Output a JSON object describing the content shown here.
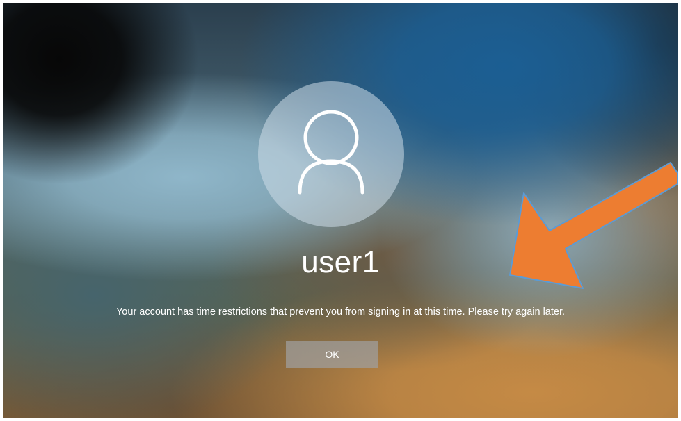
{
  "lock_screen": {
    "avatar_icon": "user-silhouette-icon",
    "username": "user1",
    "message": "Your account has time restrictions that prevent you from signing in at this time. Please try again later.",
    "ok_label": "OK"
  },
  "annotation": {
    "arrow_icon": "orange-arrow-icon",
    "arrow_color": "#ED7D31",
    "arrow_outline_color": "#5B9BD5"
  }
}
